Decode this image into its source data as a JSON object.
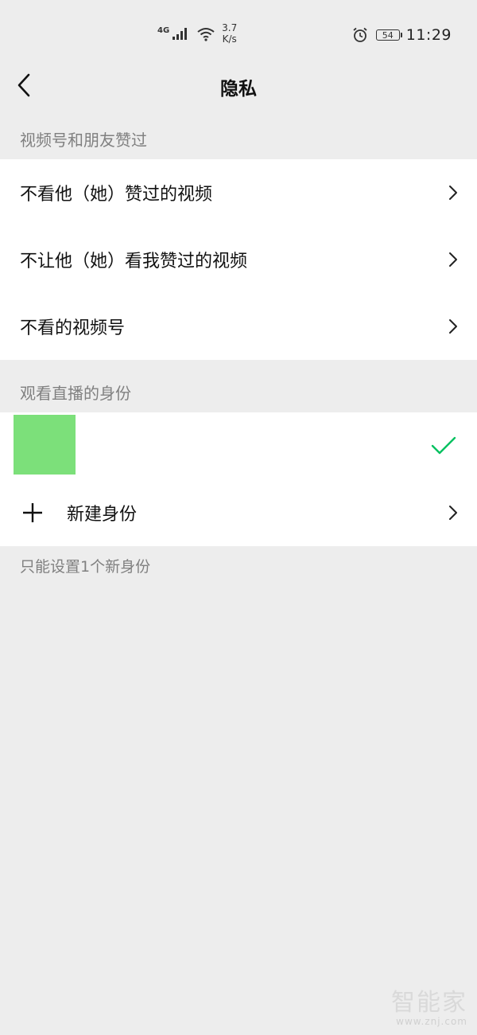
{
  "status_bar": {
    "network": "4G",
    "speed_value": "3.7",
    "speed_unit": "K/s",
    "battery": "54",
    "time": "11:29"
  },
  "nav": {
    "title": "隐私"
  },
  "section_channels": {
    "header": "视频号和朋友赞过",
    "items": [
      {
        "label": "不看他（她）赞过的视频"
      },
      {
        "label": "不让他（她）看我赞过的视频"
      },
      {
        "label": "不看的视频号"
      }
    ]
  },
  "section_live": {
    "header": "观看直播的身份",
    "new_identity_label": "新建身份",
    "footnote": "只能设置1个新身份"
  },
  "watermark": {
    "title": "智能家",
    "url": "www.znj.com"
  },
  "colors": {
    "background": "#ededed",
    "card": "#ffffff",
    "accent_green": "#07c160",
    "avatar_green": "#7ce07a",
    "secondary_text": "#808080"
  }
}
